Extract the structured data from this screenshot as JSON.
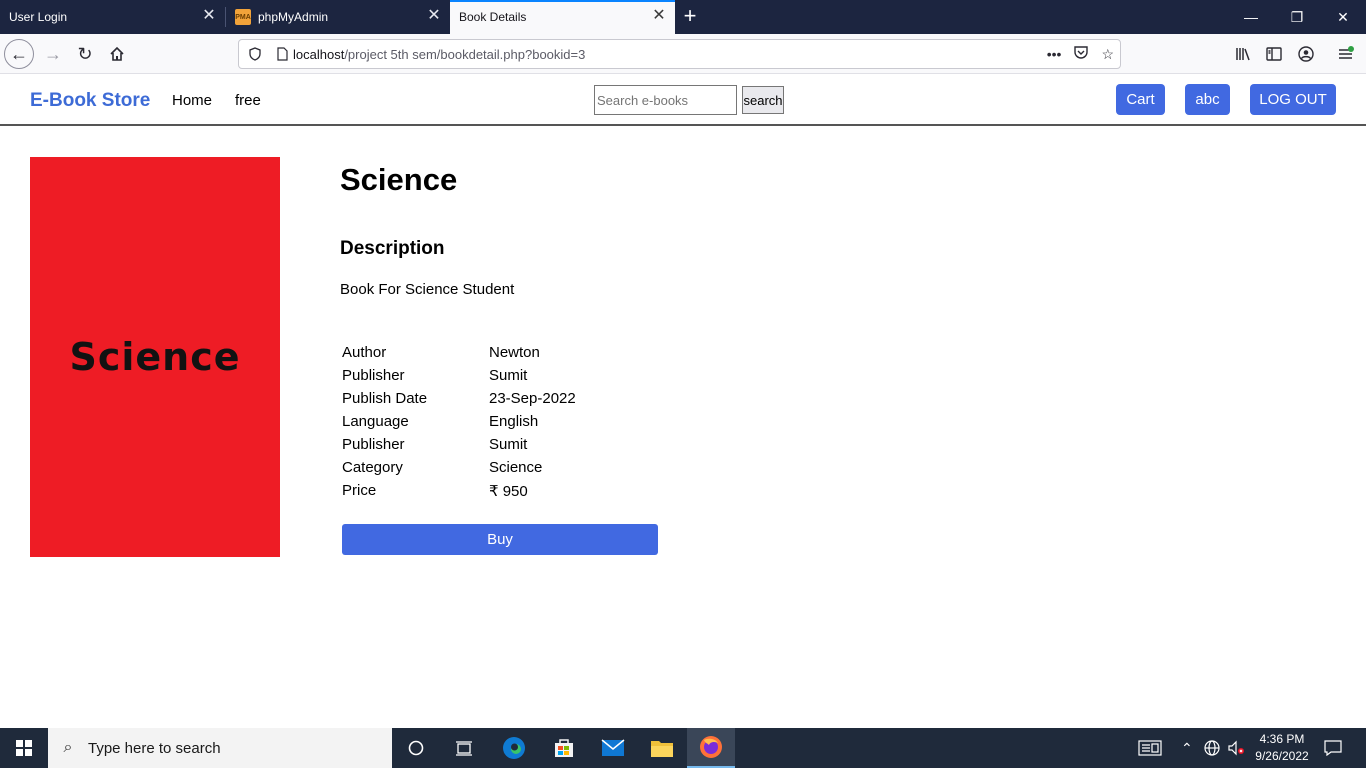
{
  "browser": {
    "tabs": [
      {
        "title": "User Login"
      },
      {
        "title": "phpMyAdmin",
        "favicon": "PMA"
      },
      {
        "title": "Book Details"
      }
    ],
    "url_host": "localhost",
    "url_path": "/project 5th sem/bookdetail.php?bookid=3",
    "url_more": "•••"
  },
  "site": {
    "brand": "E-Book Store",
    "nav": {
      "home": "Home",
      "free": "free"
    },
    "search": {
      "placeholder": "Search e-books",
      "button": "search"
    },
    "buttons": {
      "cart": "Cart",
      "user": "abc",
      "logout": "LOG OUT"
    },
    "colors": {
      "accent": "#4169e1",
      "brand": "#3d6bd6",
      "cover": "#ee1c25"
    }
  },
  "book": {
    "cover_text": "Science",
    "title": "Science",
    "description_heading": "Description",
    "description": "Book For Science Student",
    "details": [
      {
        "label": "Author",
        "value": "Newton"
      },
      {
        "label": "Publisher",
        "value": "Sumit"
      },
      {
        "label": "Publish Date",
        "value": "23-Sep-2022"
      },
      {
        "label": "Language",
        "value": "English"
      },
      {
        "label": "Publisher",
        "value": "Sumit"
      },
      {
        "label": "Category",
        "value": "Science"
      },
      {
        "label": "Price",
        "value": "₹ 950"
      }
    ],
    "buy_label": "Buy"
  },
  "taskbar": {
    "search_placeholder": "Type here to search",
    "time": "4:36 PM",
    "date": "9/26/2022"
  }
}
